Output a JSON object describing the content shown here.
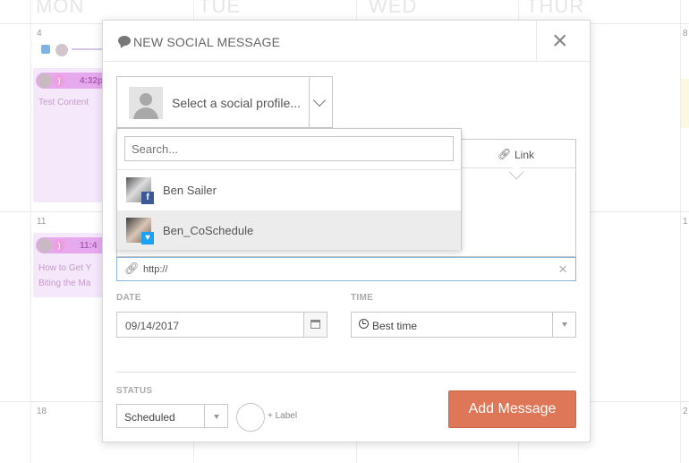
{
  "calendar": {
    "days": [
      "MON",
      "TUE",
      "WED",
      "THUR"
    ],
    "day_numbers": [
      "4",
      "11",
      "18",
      "8",
      "1",
      "2"
    ],
    "cards": [
      {
        "time": "4:32p",
        "title": "Test Content"
      },
      {
        "time": "11:4",
        "title": "How to Get Y",
        "title2": "Biting the Ma"
      }
    ]
  },
  "modal": {
    "title": "NEW SOCIAL MESSAGE",
    "close": "×",
    "profile_select": {
      "placeholder": "Select a social profile..."
    },
    "dropdown": {
      "search_placeholder": "Search...",
      "profiles": [
        {
          "name": "Ben Sailer",
          "network": "facebook"
        },
        {
          "name": "Ben_CoSchedule",
          "network": "twitter"
        }
      ]
    },
    "tabs": {
      "link_label": "Link"
    },
    "url_field": {
      "value": "http://",
      "clear": "×"
    },
    "date": {
      "label": "DATE",
      "value": "09/14/2017"
    },
    "time": {
      "label": "TIME",
      "value": "Best time"
    },
    "status": {
      "label": "STATUS",
      "value": "Scheduled"
    },
    "add_label": "+ Label",
    "add_button": "Add Message"
  },
  "colors": {
    "accent": "#de7658",
    "card_bg": "#f6e8fb",
    "chip": "#e6a9ee",
    "facebook": "#3b5998",
    "twitter": "#1da1f2"
  }
}
